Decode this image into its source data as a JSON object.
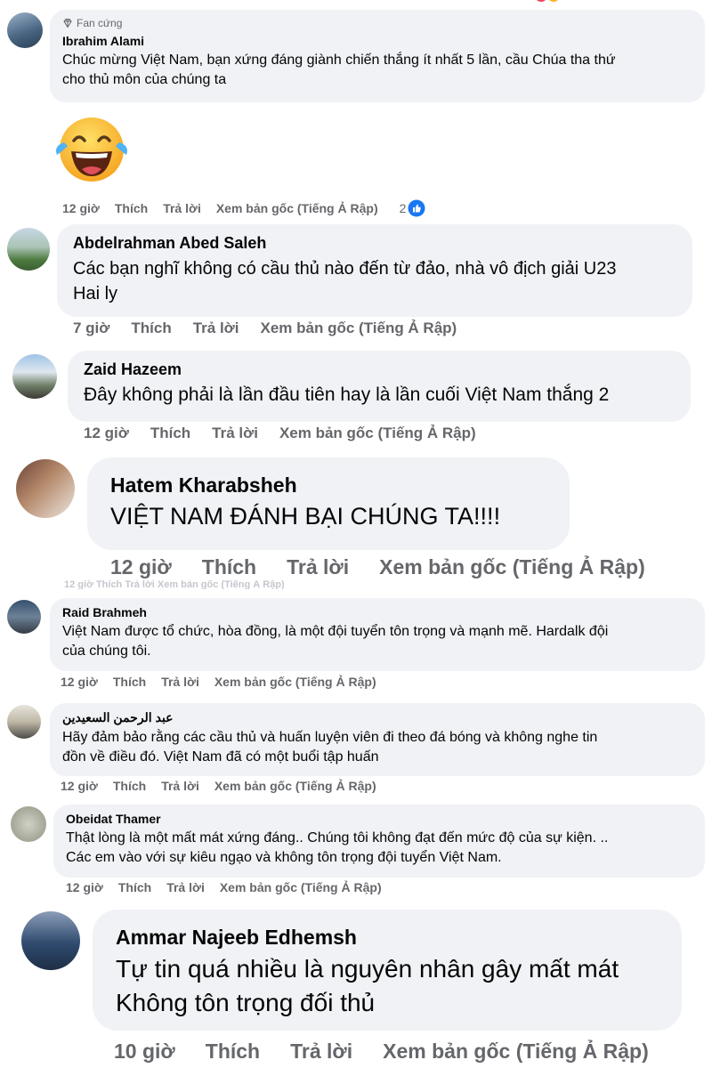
{
  "comments": [
    {
      "badge": "Fan cứng",
      "name": "Ibrahim Alami",
      "text": "Chúc mừng Việt Nam, bạn xứng đáng giành chiến thắng ít nhất 5 lần, cầu Chúa tha thứ\ncho thủ môn của chúng ta",
      "time": "12 giờ",
      "like": "Thích",
      "reply": "Trả lời",
      "see_original": "Xem bản gốc (Tiếng Ả Rập)",
      "reaction_count": "2"
    },
    {
      "name": "Abdelrahman Abed Saleh",
      "text": "Các bạn nghĩ không có cầu thủ nào đến từ đảo, nhà vô địch giải U23\nHai ly",
      "time": "7 giờ",
      "like": "Thích",
      "reply": "Trả lời",
      "see_original": "Xem bản gốc (Tiếng Ả Rập)"
    },
    {
      "name": "Zaid Hazeem",
      "text": "Đây không phải là lần đầu tiên hay là lần cuối Việt Nam thắng 2",
      "time": "12 giờ",
      "like": "Thích",
      "reply": "Trả lời",
      "see_original": "Xem bản gốc (Tiếng Ả Rập)"
    },
    {
      "name": "Hatem Kharabsheh",
      "text": "VIỆT NAM ĐÁNH BẠI CHÚNG TA!!!!",
      "time": "12 giờ",
      "like": "Thích",
      "reply": "Trả lời",
      "see_original": "Xem bản gốc (Tiếng Ả Rập)"
    },
    {
      "name": "Raid Brahmeh",
      "text": "Việt Nam được tổ chức, hòa đồng, là một đội tuyển tôn trọng và mạnh mẽ. Hardalk đội\ncủa chúng tôi.",
      "time": "12 giờ",
      "like": "Thích",
      "reply": "Trả lời",
      "see_original": "Xem bản gốc (Tiếng Ả Rập)"
    },
    {
      "name": "عبد الرحمن السعيدين",
      "text": "Hãy đảm bảo rằng các cầu thủ và huấn luyện viên đi theo đá bóng và không nghe tin\nđồn về điều đó. Việt Nam đã có một buổi tập huấn",
      "time": "12 giờ",
      "like": "Thích",
      "reply": "Trả lời",
      "see_original": "Xem bản gốc (Tiếng Ả Rập)"
    },
    {
      "name": "Obeidat Thamer",
      "text": "Thật lòng là một mất mát xứng đáng.. Chúng tôi không đạt đến mức độ của sự kiện. ..\nCác em vào với sự kiêu ngạo và không tôn trọng đội tuyển Việt Nam.",
      "time": "12 giờ",
      "like": "Thích",
      "reply": "Trả lời",
      "see_original": "Xem bản gốc (Tiếng Ả Rập)"
    },
    {
      "name": "Ammar Najeeb Edhemsh",
      "text": "Tự tin quá nhiều là nguyên nhân gây mất mát\nKhông tôn trọng đối thủ",
      "time": "10 giờ",
      "like": "Thích",
      "reply": "Trả lời",
      "see_original": "Xem bản gốc (Tiếng Ả Rập)"
    }
  ],
  "faded_row": "12 giờ   Thích   Trả lời   Xem bản gốc (Tiếng Ả Rập)",
  "icons": {
    "badge": "diamond-icon",
    "sticker": "laughing-tears-emoji",
    "reaction": "like-reaction-icon"
  },
  "colors": {
    "bubble": "#f0f2f5",
    "secondary_text": "#65676b",
    "like_blue": "#1877f2"
  }
}
